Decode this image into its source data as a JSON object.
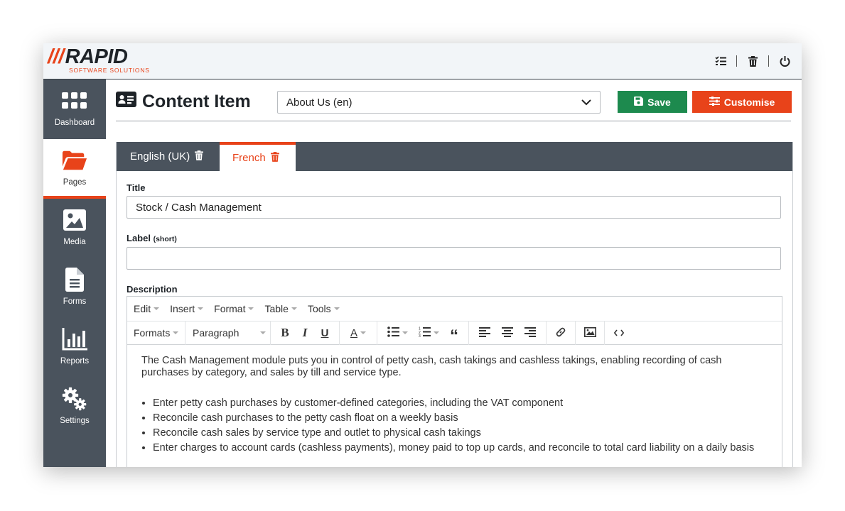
{
  "app": {
    "logo_slashes": "///",
    "logo_text": "RAPID",
    "logo_sub": "SOFTWARE SOLUTIONS"
  },
  "topbar": {
    "icons": [
      "tasks-icon",
      "trash-icon",
      "power-icon"
    ]
  },
  "sidebar": {
    "items": [
      {
        "label": "Dashboard",
        "icon": "grid-icon"
      },
      {
        "label": "Pages",
        "icon": "folder-open-icon"
      },
      {
        "label": "Media",
        "icon": "image-icon"
      },
      {
        "label": "Forms",
        "icon": "file-text-icon"
      },
      {
        "label": "Reports",
        "icon": "bar-chart-icon"
      },
      {
        "label": "Settings",
        "icon": "cogs-icon"
      }
    ],
    "active": "Pages"
  },
  "header": {
    "title": "Content Item",
    "selected_item": "About Us (en)",
    "save_label": "Save",
    "customise_label": "Customise"
  },
  "tabs": [
    {
      "label": "English (UK)"
    },
    {
      "label": "French"
    }
  ],
  "form": {
    "title_label": "Title",
    "title_value": "Stock / Cash Management",
    "label_label": "Label",
    "label_hint": "(short)",
    "label_value": "",
    "description_label": "Description"
  },
  "editor": {
    "menu": [
      "Edit",
      "Insert",
      "Format",
      "Table",
      "Tools"
    ],
    "formats_label": "Formats",
    "block_label": "Paragraph",
    "intro": "The Cash Management module puts you in control of petty cash, cash takings and cashless takings, enabling recording of cash purchases by category, and sales by till and service type.",
    "bullets": [
      "Enter petty cash purchases by customer-defined categories, including the VAT component",
      "Reconcile cash purchases to the petty cash float on a weekly basis",
      "Reconcile cash sales by service type and outlet to physical cash takings",
      "Enter charges to account cards (cashless payments), money paid to top up cards, and reconcile to total card liability on a daily basis"
    ]
  },
  "colors": {
    "accent": "#e8431a",
    "save": "#1d8a4e",
    "sidebar": "#4a535d",
    "dark": "#1e2328"
  }
}
